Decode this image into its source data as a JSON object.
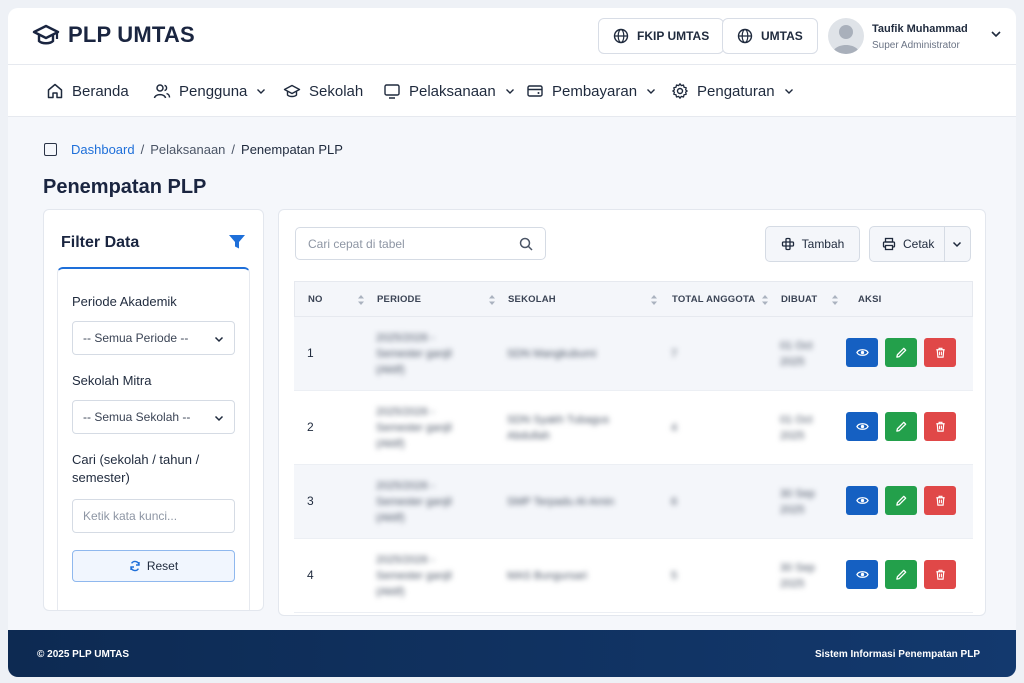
{
  "app": {
    "brand": "PLP UMTAS"
  },
  "header": {
    "links": [
      {
        "label": "FKIP UMTAS",
        "icon": "globe-icon"
      },
      {
        "label": "UMTAS",
        "icon": "globe-icon"
      }
    ],
    "user": {
      "name": "Taufik Muhammad",
      "role": "Super Administrator"
    }
  },
  "nav": [
    {
      "label": "Beranda",
      "icon": "home-icon",
      "dropdown": false
    },
    {
      "label": "Pengguna",
      "icon": "users-icon",
      "dropdown": true
    },
    {
      "label": "Sekolah",
      "icon": "graduation-cap-icon",
      "dropdown": false
    },
    {
      "label": "Pelaksanaan",
      "icon": "monitor-icon",
      "dropdown": true
    },
    {
      "label": "Pembayaran",
      "icon": "card-icon",
      "dropdown": true
    },
    {
      "label": "Pengaturan",
      "icon": "gear-icon",
      "dropdown": true
    }
  ],
  "breadcrumb": [
    "Dashboard",
    "Pelaksanaan",
    "Penempatan PLP"
  ],
  "page_title": "Penempatan PLP",
  "filter": {
    "title": "Filter Data",
    "periode_label": "Periode Akademik",
    "periode_value": "-- Semua Periode --",
    "sekolah_label": "Sekolah Mitra",
    "sekolah_value": "-- Semua Sekolah --",
    "search_label": "Cari (sekolah / tahun / semester)",
    "search_placeholder": "Ketik kata kunci...",
    "reset_label": "Reset"
  },
  "table": {
    "search_placeholder": "Cari cepat di tabel",
    "add_label": "Tambah",
    "print_label": "Cetak",
    "columns": [
      "NO",
      "PERIODE",
      "SEKOLAH",
      "TOTAL ANGGOTA",
      "DIBUAT",
      "AKSI"
    ],
    "rows": [
      {
        "no": "1",
        "periode": "2025/2026 - Semester ganjil (Aktif)",
        "sekolah": "SDN Mangkubumi",
        "total": "7",
        "dibuat": "01 Oct 2025"
      },
      {
        "no": "2",
        "periode": "2025/2026 - Semester ganjil (Aktif)",
        "sekolah": "SDN Syakh Tubagus Abdullah",
        "total": "4",
        "dibuat": "01 Oct 2025"
      },
      {
        "no": "3",
        "periode": "2025/2026 - Semester ganjil (Aktif)",
        "sekolah": "SMP Terpadu Al-Amin",
        "total": "6",
        "dibuat": "30 Sep 2025"
      },
      {
        "no": "4",
        "periode": "2025/2026 - Semester ganjil (Aktif)",
        "sekolah": "MAS Bungursari",
        "total": "5",
        "dibuat": "30 Sep 2025"
      }
    ]
  },
  "footer": {
    "left": "© 2025 PLP UMTAS",
    "right": "Sistem Informasi Penempatan PLP"
  },
  "colors": {
    "accent": "#1e6fd9",
    "view": "#1560c2",
    "edit": "#23a04b",
    "delete": "#e04848",
    "footer": "#0d2a52"
  }
}
